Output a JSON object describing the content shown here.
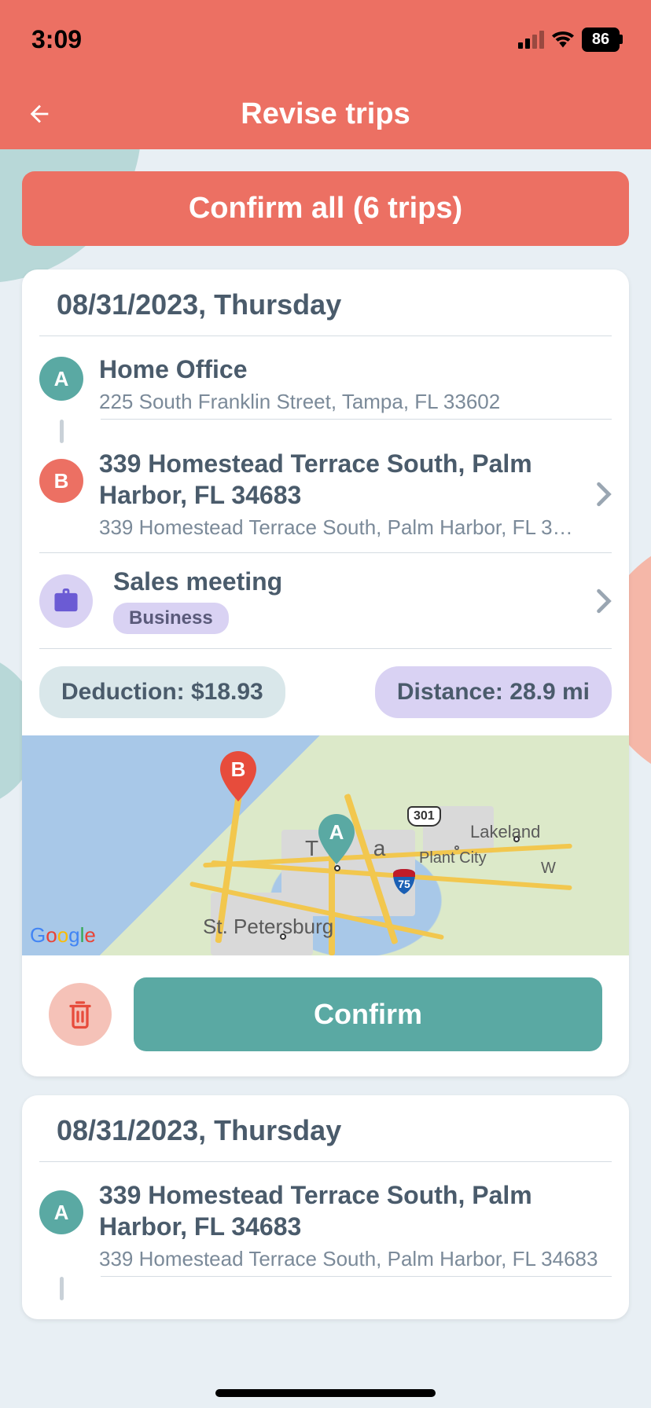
{
  "status": {
    "time": "3:09",
    "battery": "86"
  },
  "header": {
    "title": "Revise trips"
  },
  "confirm_all_label": "Confirm all (6 trips)",
  "card1": {
    "date": "08/31/2023, Thursday",
    "point_a": {
      "letter": "A",
      "title": "Home Office",
      "subtitle": "225 South Franklin Street, Tampa,  FL 33602"
    },
    "point_b": {
      "letter": "B",
      "title": "339 Homestead Terrace South, Palm Harbor, FL 34683",
      "subtitle": "339 Homestead Terrace South, Palm Harbor,  FL 34…"
    },
    "purpose": {
      "title": "Sales meeting",
      "badge": "Business"
    },
    "deduction_label": "Deduction: $18.93",
    "distance_label": "Distance: 28.9 mi",
    "map": {
      "pin_a": "A",
      "pin_b": "B",
      "label_tampa": "Tampa",
      "label_stpete": "St. Petersburg",
      "label_lakeland": "Lakeland",
      "label_plantcity": "Plant City",
      "label_w": "W",
      "shield_301": "301",
      "shield_75": "75"
    },
    "confirm_label": "Confirm"
  },
  "card2": {
    "date": "08/31/2023, Thursday",
    "point_a": {
      "letter": "A",
      "title": "339 Homestead Terrace South, Palm Harbor, FL 34683",
      "subtitle": "339 Homestead Terrace South, Palm Harbor,  FL 34683"
    }
  }
}
